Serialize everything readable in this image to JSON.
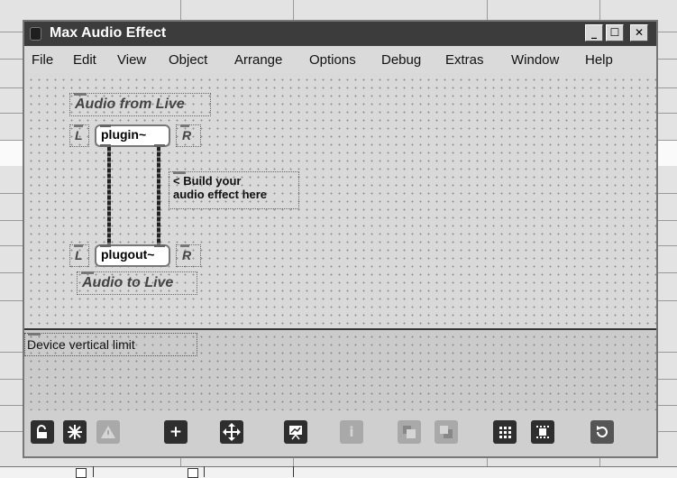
{
  "window": {
    "title": "Max Audio Effect",
    "buttons": {
      "minimize": "_",
      "maximize": "☐",
      "close": "✕"
    }
  },
  "menu": [
    "File",
    "Edit",
    "View",
    "Object",
    "Arrange",
    "Options",
    "Debug",
    "Extras",
    "Window",
    "Help"
  ],
  "patcher": {
    "comment_audio_from": "Audio from Live",
    "label_left": "L",
    "label_right": "R",
    "plugin_object": "plugin~",
    "plugout_object": "plugout~",
    "build_note_line1": "< Build your",
    "build_note_line2": "audio effect here",
    "comment_audio_to": "Audio to Live",
    "device_limit_label": "Device vertical limit"
  },
  "toolbar": {
    "icons": [
      "lock-icon",
      "snowflake-icon",
      "warning-icon",
      "add-object-icon",
      "move-arrows-icon",
      "presentation-icon",
      "info-icon",
      "layer-front-icon",
      "layer-back-icon",
      "grid-icon",
      "snap-grid-icon",
      "zoom-reset-icon"
    ]
  },
  "colors": {
    "titlebar": "#3c3c3c",
    "canvas": "#d9d9d9",
    "toolbar_dark": "#2e2e2e",
    "toolbar_dim": "#a9a9a9"
  }
}
